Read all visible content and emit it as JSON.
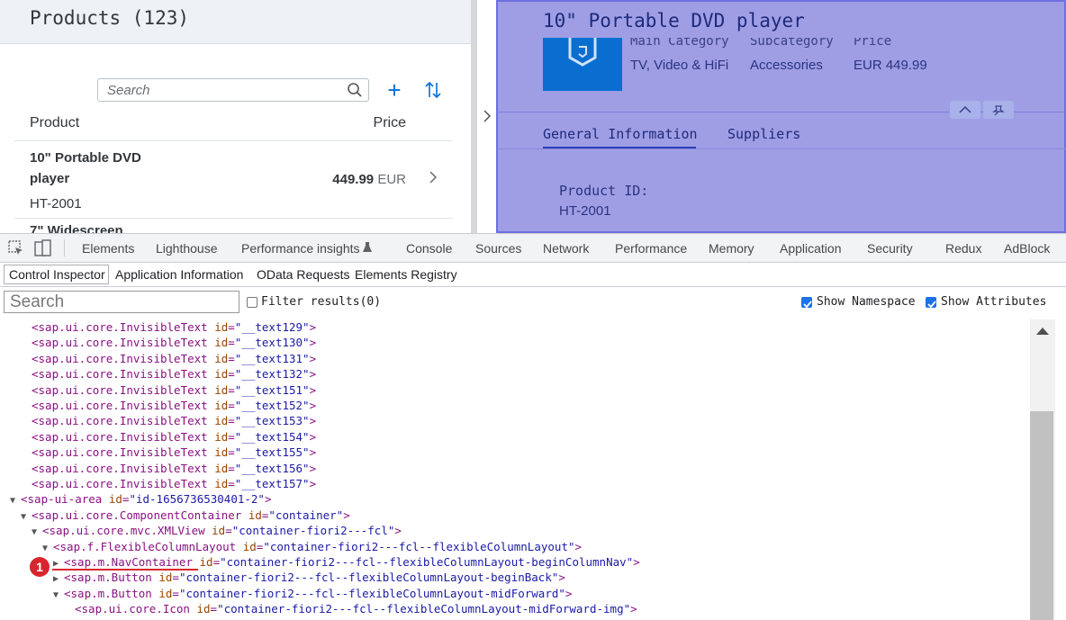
{
  "app": {
    "list": {
      "title": "Products (123)",
      "search_placeholder": "Search",
      "columns": [
        "Product",
        "Price"
      ],
      "rows": [
        {
          "name": "10\" Portable DVD player",
          "id": "HT-2001",
          "price": "449.99",
          "currency": "EUR"
        },
        {
          "name": "7\" Widescreen"
        }
      ]
    },
    "detail": {
      "title": "10\" Portable DVD player",
      "header_fields": [
        {
          "label": "Main Category",
          "value": "TV, Video & HiFi"
        },
        {
          "label": "Subcategory",
          "value": "Accessories"
        },
        {
          "label": "Price",
          "value": "EUR 449.99"
        }
      ],
      "tabs": [
        "General Information",
        "Suppliers"
      ],
      "active_tab": "General Information",
      "field_label": "Product ID:",
      "field_value": "HT-2001"
    }
  },
  "devtools": {
    "tabs": [
      "Elements",
      "Lighthouse",
      "Performance insights",
      "Console",
      "Sources",
      "Network",
      "Performance",
      "Memory",
      "Application",
      "Security",
      "Redux",
      "AdBlock"
    ],
    "sub_tabs": [
      "Control Inspector",
      "Application Information",
      "OData Requests",
      "Elements Registry"
    ],
    "active_sub_tab": "Control Inspector",
    "search_placeholder": "Search",
    "filter_label": "Filter results(0)",
    "show_namespace_label": "Show Namespace",
    "show_attributes_label": "Show Attributes",
    "show_namespace_checked": true,
    "show_attributes_checked": true,
    "annotation_number": "1",
    "tree": [
      {
        "indent": 0,
        "tri": "",
        "tag": "sap.ui.core.InvisibleText",
        "id": "__text129"
      },
      {
        "indent": 0,
        "tri": "",
        "tag": "sap.ui.core.InvisibleText",
        "id": "__text130"
      },
      {
        "indent": 0,
        "tri": "",
        "tag": "sap.ui.core.InvisibleText",
        "id": "__text131"
      },
      {
        "indent": 0,
        "tri": "",
        "tag": "sap.ui.core.InvisibleText",
        "id": "__text132"
      },
      {
        "indent": 0,
        "tri": "",
        "tag": "sap.ui.core.InvisibleText",
        "id": "__text151"
      },
      {
        "indent": 0,
        "tri": "",
        "tag": "sap.ui.core.InvisibleText",
        "id": "__text152"
      },
      {
        "indent": 0,
        "tri": "",
        "tag": "sap.ui.core.InvisibleText",
        "id": "__text153"
      },
      {
        "indent": 0,
        "tri": "",
        "tag": "sap.ui.core.InvisibleText",
        "id": "__text154"
      },
      {
        "indent": 0,
        "tri": "",
        "tag": "sap.ui.core.InvisibleText",
        "id": "__text155"
      },
      {
        "indent": 0,
        "tri": "",
        "tag": "sap.ui.core.InvisibleText",
        "id": "__text156"
      },
      {
        "indent": 0,
        "tri": "",
        "tag": "sap.ui.core.InvisibleText",
        "id": "__text157"
      },
      {
        "indent": -1,
        "tri": "▼",
        "tag": "sap-ui-area",
        "id": "id-1656736530401-2"
      },
      {
        "indent": 0,
        "tri": "▼",
        "tag": "sap.ui.core.ComponentContainer",
        "id": "container"
      },
      {
        "indent": 1,
        "tri": "▼",
        "tag": "sap.ui.core.mvc.XMLView",
        "id": "container-fiori2---fcl"
      },
      {
        "indent": 2,
        "tri": "▼",
        "tag": "sap.f.FlexibleColumnLayout",
        "id": "container-fiori2---fcl--flexibleColumnLayout"
      },
      {
        "indent": 3,
        "tri": "▶",
        "tag": "sap.m.NavContainer",
        "id": "container-fiori2---fcl--flexibleColumnLayout-beginColumnNav"
      },
      {
        "indent": 3,
        "tri": "▶",
        "tag": "sap.m.Button",
        "id": "container-fiori2---fcl--flexibleColumnLayout-beginBack"
      },
      {
        "indent": 3,
        "tri": "▼",
        "tag": "sap.m.Button",
        "id": "container-fiori2---fcl--flexibleColumnLayout-midForward"
      },
      {
        "indent": 4,
        "tri": "",
        "tag": "sap.ui.core.Icon",
        "id": "container-fiori2---fcl--flexibleColumnLayout-midForward-img"
      }
    ]
  }
}
